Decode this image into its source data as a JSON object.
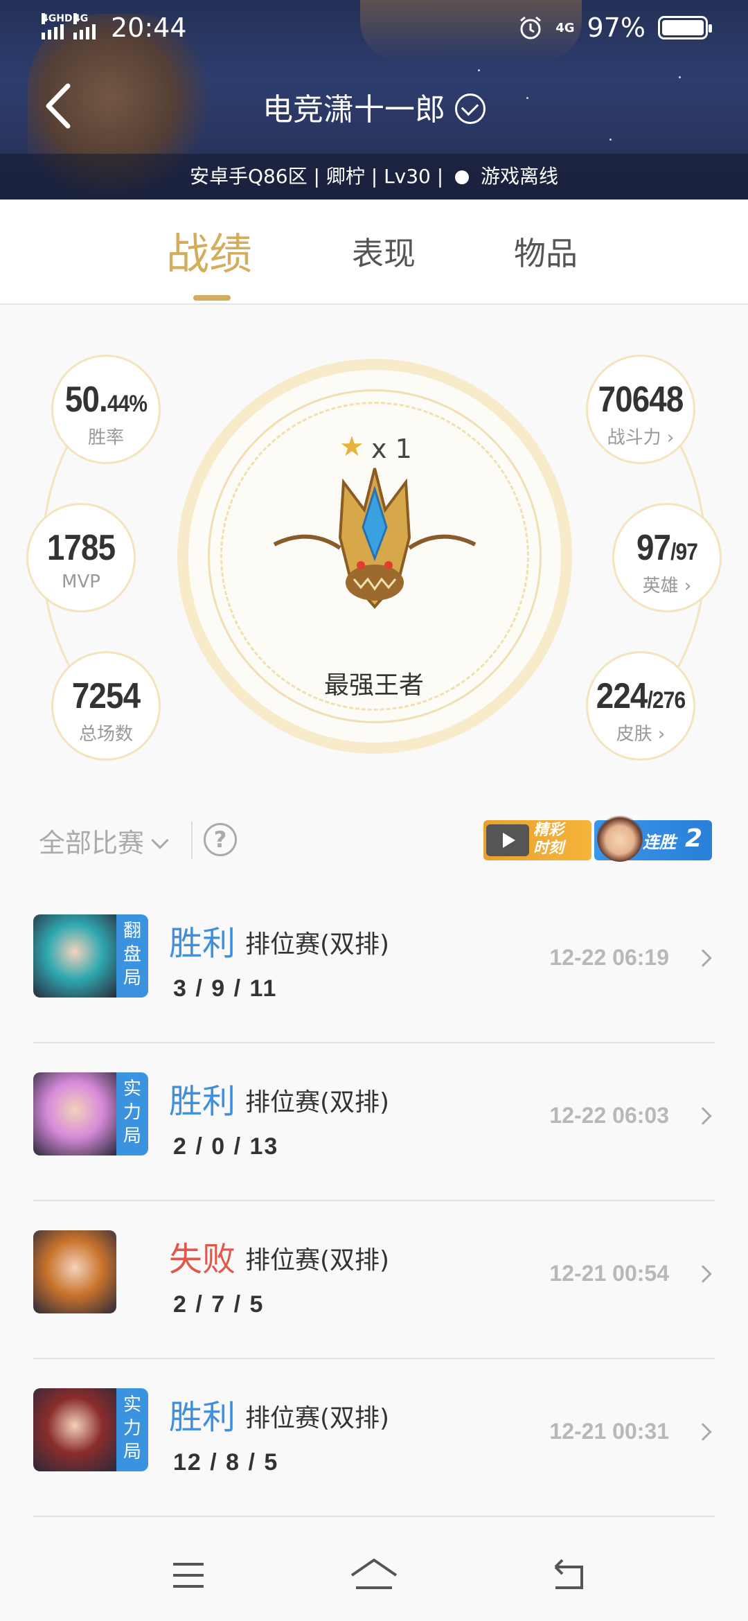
{
  "status_bar": {
    "network1": "4GHD",
    "network2": "4G",
    "time": "20:44",
    "network3": "4G",
    "battery": "97%"
  },
  "header": {
    "back_icon": "back-arrow-icon",
    "title": "电竞潇十一郎",
    "verified_icon": "check-circle-icon",
    "subtitle_text": "安卓手Q86区 | 卿柠 | Lv30 |",
    "online_status": "游戏离线"
  },
  "tabs": [
    {
      "label": "战绩",
      "active": true
    },
    {
      "label": "表现",
      "active": false
    },
    {
      "label": "物品",
      "active": false
    }
  ],
  "stats": {
    "win_rate": {
      "value": "50.",
      "decimal": "44%",
      "label": "胜率"
    },
    "mvp": {
      "value": "1785",
      "label": "MVP"
    },
    "total_games": {
      "value": "7254",
      "label": "总场数"
    },
    "power": {
      "value": "70648",
      "label": "战斗力"
    },
    "heroes": {
      "value": "97",
      "total": "/97",
      "label": "英雄"
    },
    "skins": {
      "value": "224",
      "total": "/276",
      "label": "皮肤"
    }
  },
  "rank": {
    "stars": "x 1",
    "name": "最强王者",
    "star_icon": "star-icon"
  },
  "filter": {
    "selected": "全部比赛",
    "help_icon": "question-circle-icon",
    "highlight_line1": "精彩",
    "highlight_line2": "时刻",
    "streak_label": "连胜",
    "streak_count": "2"
  },
  "matches": [
    {
      "tag": [
        "翻",
        "盘",
        "局"
      ],
      "result": "胜利",
      "outcome": "win",
      "mode": "排位赛(双排)",
      "kda": "3 / 9 / 11",
      "time": "12-22 06:19",
      "hero_color": "#2fa8b0"
    },
    {
      "tag": [
        "实",
        "力",
        "局"
      ],
      "result": "胜利",
      "outcome": "win",
      "mode": "排位赛(双排)",
      "kda": "2 / 0 / 13",
      "time": "12-22 06:03",
      "hero_color": "#d78ad9"
    },
    {
      "tag": [],
      "result": "失败",
      "outcome": "lose",
      "mode": "排位赛(双排)",
      "kda": "2 / 7 / 5",
      "time": "12-21 00:54",
      "hero_color": "#c9732c"
    },
    {
      "tag": [
        "实",
        "力",
        "局"
      ],
      "result": "胜利",
      "outcome": "win",
      "mode": "排位赛(双排)",
      "kda": "12 / 8 / 5",
      "time": "12-21 00:31",
      "hero_color": "#8a2c2c"
    }
  ],
  "colors": {
    "accent_gold": "#d3ac5c",
    "win_blue": "#3e8fe0",
    "lose_red": "#e0584a",
    "tag_blue": "#3b93e0"
  },
  "navbar": {
    "menu_icon": "menu-icon",
    "home_icon": "home-icon",
    "back_icon": "return-icon"
  }
}
